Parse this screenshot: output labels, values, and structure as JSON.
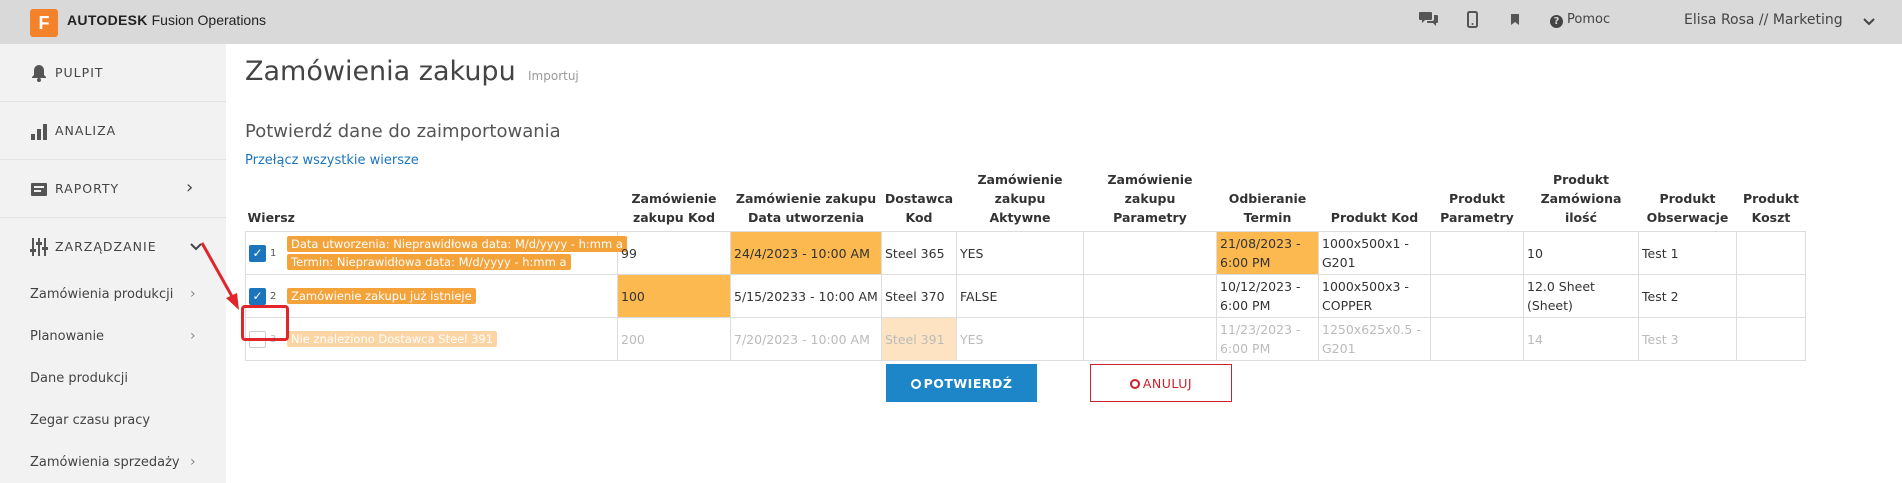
{
  "header": {
    "logo_letter": "F",
    "brand_bold": "AUTODESK",
    "brand_rest": "Fusion Operations",
    "help_label": "Pomoc",
    "user_label": "Elisa Rosa // Marketing",
    "icons": [
      "chat-icon",
      "mobile-icon",
      "bookmark-icon",
      "help-icon",
      "chevron-down-icon"
    ]
  },
  "sidebar": {
    "main_items": [
      {
        "label": "PULPIT",
        "icon": "bell-icon"
      },
      {
        "label": "ANALIZA",
        "icon": "bar-chart-icon"
      },
      {
        "label": "RAPORTY",
        "icon": "report-icon",
        "chevron": "›"
      },
      {
        "label": "ZARZĄDZANIE",
        "icon": "sliders-icon",
        "chevron": "⌄"
      }
    ],
    "sub_items": [
      {
        "label": "Zamówienia produkcji",
        "chevron": "›"
      },
      {
        "label": "Planowanie",
        "chevron": "›"
      },
      {
        "label": "Dane produkcji"
      },
      {
        "label": "Zegar czasu pracy"
      },
      {
        "label": "Zamówienia sprzedaży",
        "chevron": "›"
      }
    ]
  },
  "main": {
    "title": "Zamówienia zakupu",
    "import_link": "Importuj",
    "subtitle": "Potwierdź dane do zaimportowania",
    "toggle_all": "Przełącz wszystkie wiersze",
    "columns": [
      [
        "Wiersz"
      ],
      [
        "Zamówienie",
        "zakupu Kod"
      ],
      [
        "Zamówienie zakupu",
        "Data utworzenia"
      ],
      [
        "Dostawca",
        "Kod"
      ],
      [
        "Zamówienie zakupu",
        "Aktywne"
      ],
      [
        "Zamówienie zakupu",
        "Parametry"
      ],
      [
        "Odbieranie",
        "Termin"
      ],
      [
        "Produkt Kod"
      ],
      [
        "Produkt",
        "Parametry"
      ],
      [
        "Produkt",
        "Zamówiona ilość"
      ],
      [
        "Produkt",
        "Obserwacje"
      ],
      [
        "Produkt",
        "Koszt"
      ]
    ],
    "rows": [
      {
        "checked": true,
        "num": "1",
        "errors": [
          "Data utworzenia: Nieprawidłowa data: M/d/yyyy - h:mm a",
          "Termin: Nieprawidłowa data: M/d/yyyy - h:mm a"
        ],
        "cells": [
          "99",
          "24/4/2023 - 10:00 AM",
          "Steel 365",
          "YES",
          "",
          "21/08/2023 - 6:00 PM",
          "1000x500x1 - G201",
          "",
          "10",
          "Test 1",
          ""
        ],
        "highlight": [
          false,
          true,
          false,
          false,
          false,
          true,
          false,
          false,
          false,
          false,
          false
        ]
      },
      {
        "checked": true,
        "num": "2",
        "errors": [
          "Zamówienie zakupu już istnieje"
        ],
        "cells": [
          "100",
          "5/15/20233 - 10:00 AM",
          "Steel 370",
          "FALSE",
          "",
          "10/12/2023 - 6:00 PM",
          "1000x500x3 - COPPER",
          "",
          "12.0 Sheet (Sheet)",
          "Test 2",
          ""
        ],
        "highlight": [
          true,
          false,
          false,
          false,
          false,
          false,
          false,
          false,
          false,
          false,
          false
        ]
      },
      {
        "checked": false,
        "num": "3",
        "errors": [
          "Nie znaleziono Dostawca Steel 391"
        ],
        "cells": [
          "200",
          "7/20/2023 - 10:00 AM",
          "Steel 391",
          "YES",
          "",
          "11/23/2023 - 6:00 PM",
          "1250x625x0.5 - G201",
          "",
          "14",
          "Test 3",
          ""
        ],
        "highlight": [
          false,
          false,
          true,
          false,
          false,
          false,
          false,
          false,
          false,
          false,
          false
        ]
      }
    ],
    "confirm_label": "POTWIERDŹ",
    "cancel_label": "ANULUJ"
  },
  "colors": {
    "accent": "#1c86c8",
    "error": "#f4a23a",
    "highlight": "#fcb950",
    "cancel": "#c8232c",
    "annotation": "#e0262a"
  }
}
